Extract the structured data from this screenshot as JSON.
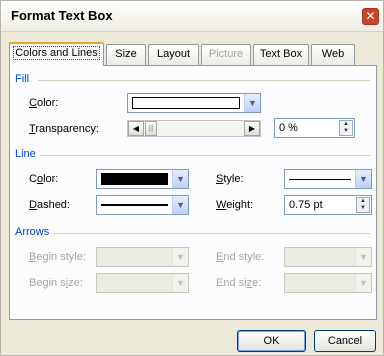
{
  "window": {
    "title": "Format Text Box",
    "close_glyph": "✕"
  },
  "tabs": [
    {
      "label": "Colors and Lines",
      "active": true,
      "disabled": false
    },
    {
      "label": "Size",
      "active": false,
      "disabled": false
    },
    {
      "label": "Layout",
      "active": false,
      "disabled": false
    },
    {
      "label": "Picture",
      "active": false,
      "disabled": true
    },
    {
      "label": "Text Box",
      "active": false,
      "disabled": false
    },
    {
      "label": "Web",
      "active": false,
      "disabled": false
    }
  ],
  "fill": {
    "heading": "Fill",
    "color_label": "Color:",
    "transparency_label": "Transparency:",
    "transparency_value": "0 %",
    "transparency_level_percent": 0,
    "color_value": "#ffffff"
  },
  "line": {
    "heading": "Line",
    "color_label": "Color:",
    "color_value": "#000000",
    "dashed_label": "Dashed:",
    "style_label": "Style:",
    "weight_label": "Weight:",
    "weight_value": "0.75 pt"
  },
  "arrows": {
    "heading": "Arrows",
    "begin_style_label": "Begin style:",
    "begin_size_label": "Begin size:",
    "end_style_label": "End style:",
    "end_size_label": "End size:"
  },
  "buttons": {
    "ok": "OK",
    "cancel": "Cancel"
  },
  "colors": {
    "group_heading": "#0046d5",
    "title_close": "#c8442a",
    "active_tab_accent": "#e8a23c"
  }
}
